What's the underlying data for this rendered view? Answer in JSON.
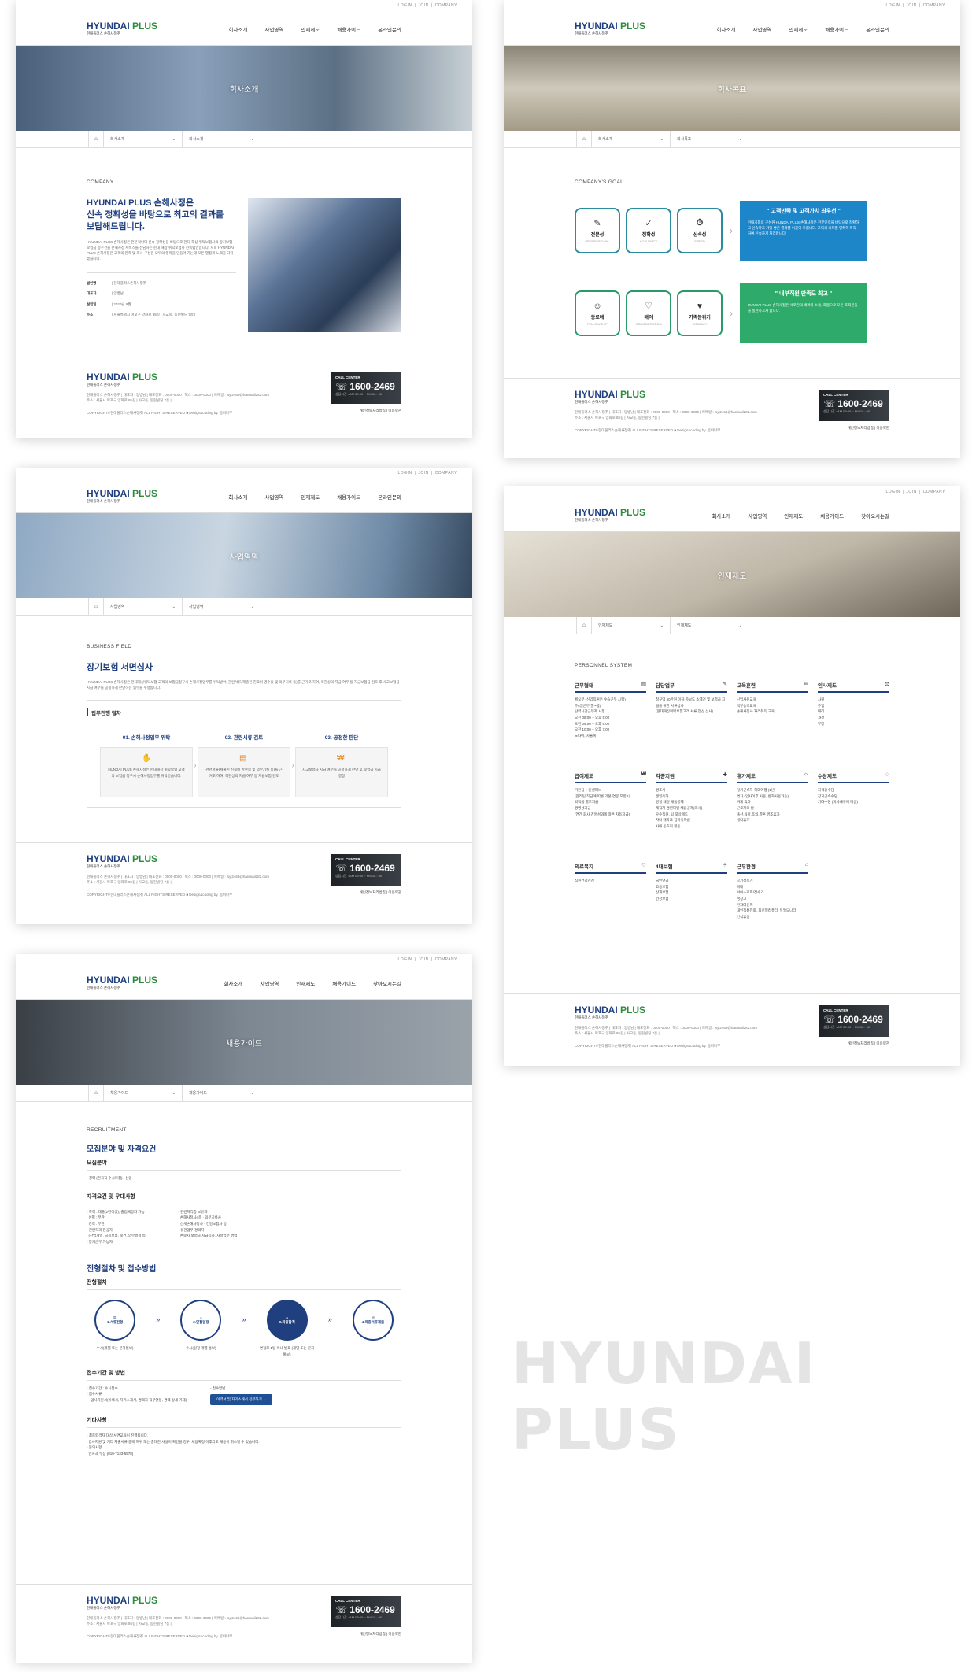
{
  "common": {
    "util": [
      "LOGIN",
      "JOIN",
      "COMPANY"
    ],
    "logo_main": "HYUNDAI ",
    "logo_accent": "PLUS",
    "logo_sub": "현대플러스 손해사정㈜",
    "menu_a": [
      "회사소개",
      "사업영역",
      "인재제도",
      "채용가이드",
      "온라인문의"
    ],
    "menu_b": [
      "회사소개",
      "사업영역",
      "인재제도",
      "채용가이드",
      "찾아오시는길"
    ],
    "footer_info": "현대플러스 손해사정㈜ | 대표자 : 양병남 | 대표전화 : 0000-0000 | 팩스 : 0000-0000 | 이메일 : lsyj2469@hanmail282.com",
    "footer_addr": "주소 : 서울시 마포구 양화로 85길 | 사교동, 동현빌딩 7층 |",
    "copyright": "COPYRIGHT©현대플러스손해사정㈜ ALL RIGHTS RESERVED ■ Design&coding by. 봄비나무",
    "cc_label": "CALL CENTER",
    "cc_number": "1600-2469",
    "cc_hours": "상담시간 : AM 09:00 ~ PM 18 : 00",
    "footer_links": "개인정보처리방침  |  이용약관"
  },
  "pageA": {
    "hero": "회사소개",
    "lnb": [
      "회사소개",
      "회사소개"
    ],
    "en": "COMPANY",
    "title1": "HYUNDAI PLUS 손해사정은",
    "title2": "신속 정확성을 바탕으로 최고의 결과를",
    "title3": "보답해드립니다.",
    "desc": "HYUNDAI PLUS 손해사정은 전문적이며 신속 정확성을 바탕으로 현대 해상 위탁보험사의 장기보험 보험금 청구건을 손해사정 서비스를 전담하는 현대 해상 위탁보험사 전속법인입니다. 저희 HYUNDAI PLUS 손해사정은 고객의 만족 및 회사 구성원 모두의 행복을 만들어 가는데 모든 열정과 노력을 다하겠습니다.",
    "info": [
      {
        "k": "법인명",
        "v": "| 현대플러스손해사정㈜"
      },
      {
        "k": "대표자",
        "v": "| 양병남"
      },
      {
        "k": "설립일",
        "v": "| 2020년 8월"
      },
      {
        "k": "주소",
        "v": "| 서울특별시 마포구 양화로 85길 | 사교동, 동현빌딩 7층 |"
      }
    ]
  },
  "pageB": {
    "hero": "회사목표",
    "lnb": [
      "회사소개",
      "회사목표"
    ],
    "en": "COMPANY'S GOAL",
    "row1": [
      {
        "t": "전문성",
        "e": "PROFESSIONAL",
        "i": "✎"
      },
      {
        "t": "정확성",
        "e": "ACCURACY",
        "i": "✓"
      },
      {
        "t": "신속성",
        "e": "SPEED",
        "i": "⏱"
      }
    ],
    "row2": [
      {
        "t": "동료애",
        "e": "FELLOWSHIP",
        "i": "☺"
      },
      {
        "t": "배려",
        "e": "CONSIDERATION",
        "i": "♡"
      },
      {
        "t": "가족분위기",
        "e": "INTIMACY",
        "i": "♥"
      }
    ],
    "big1_t": "\" 고객만족 및 고객가치 최우선 \"",
    "big1_d": "현대기룹의 구성원 HUNDAI PLUS 손해사정은 전문인력을 바탕으로 정확하고 신속하고 가장 좋은 결과를 이끌어 드립니다. 고객의 니즈를 정확히 파악하여 신속하게 처리합니다.",
    "big2_t": "\" 내부직원 만족도 최고 \"",
    "big2_d": "HUNDAI PLUS 손해사정은 서로간의 배려와 소통, 화합으로 모든 조직원들을 실현하고자 합니다."
  },
  "pageC": {
    "hero": "사업영역",
    "lnb": [
      "사업영역",
      "사업영역"
    ],
    "en": "BUSINESS FIELD",
    "title": "장기보험 서면심사",
    "desc": "HYUNDAI PLUS 손해사정은 현대해상위탁보험 고객의 보험금청구시 손해사정업무를 위탁받아, 관련서류(제출된 진료비 영수증 및 의무기록 등)를 근거로 하여, 약관상의 지급 여부 등 지급보험금 검토 후 사고보험금 지급 여부를 공정하게 판단하는 업무를 수행합니다.",
    "proc": "업무진행 절차",
    "steps": [
      {
        "t": "01. 손해사정업무 위탁",
        "d": "HUNDAI PLUS 손해사정은 현대해상 위탁보험 고객의 보험금 청구시 손해사정업무를 위탁받습니다."
      },
      {
        "t": "02. 관련서류 검토",
        "d": "관련서류(제출된 진료비 영수증 및 의무기록 등)를 근거로 하여, 약관상의 지급 여부 등 지급보험 검토"
      },
      {
        "t": "03. 공정한 판단",
        "d": "사고보험금 지급 여부를 공정하게 판단 후 보험금 지급 결정"
      }
    ]
  },
  "pageD": {
    "hero": "인재제도",
    "lnb": [
      "인재제도",
      "인재제도"
    ],
    "en": "PERSONNEL SYSTEM",
    "cols": [
      {
        "t": "근무형태",
        "i": "▤",
        "items": [
          "월요부 (신입직원은 수습근무 시행)",
          "주5일근무(월~금)",
          "탄력시간근무제 시행",
          "오전 08:00 ~ 오후 5:00",
          "오전 09:00 ~ 오후 6:00",
          "오전 10:00 ~ 오후 7:00",
          "노타이, 자율복"
        ]
      },
      {
        "t": "담당업무",
        "i": "✎",
        "items": [
          "청구액 50만원 이하 자보도 소액건 및 보험금 지급을 위한 서류심사",
          "(현대해상위탁보험고객 서류 전산 심사)"
        ]
      },
      {
        "t": "교육훈련",
        "i": "✏",
        "items": [
          "신입사원교육",
          "직무능력교육",
          "손해사정사 자격취득 교육"
        ]
      },
      {
        "t": "인사제도",
        "i": "⚖",
        "items": [
          "사원",
          "주임",
          "대리",
          "과장",
          "부장"
        ]
      },
      {
        "t": "급여제도",
        "i": "₩",
        "items": [
          "기본급 + 인센티브",
          "(관리팀 직급에 따른 기본 연봉 포함시)",
          "퇴직금 별도지급",
          "경영성과금",
          "(연간 회사 경영성과에 따른 차등지급)"
        ]
      },
      {
        "t": "각종지원",
        "i": "✚",
        "items": [
          "경조사",
          "생일축하",
          "명절 내일 채움공제",
          "제직자 명년대일 채움공제(회사)",
          "우수직원, 팀 포상제도",
          "자녀 대학교 입학축하금",
          "사내 동호회 활동"
        ]
      },
      {
        "t": "휴가제도",
        "i": "☼",
        "items": [
          "정기근속자 해외여행 (1년)",
          "연차 (입사이후 사용, 반차사용가능)",
          "하계 휴가",
          "근로자의 날",
          "출산,육아,조의,결혼 경조휴가",
          "생리휴가"
        ]
      },
      {
        "t": "수당제도",
        "i": "♢",
        "items": [
          "자격증수당",
          "장기근속수당",
          "기타수당 (회사내규에 따름)"
        ]
      },
      {
        "t": "의료복지",
        "i": "♡",
        "items": [
          "직원건강검진"
        ]
      },
      {
        "t": "4대보험",
        "i": "☂",
        "items": [
          "국민연금",
          "고용보험",
          "산재보험",
          "건강보험"
        ]
      },
      {
        "t": "근무환경",
        "i": "⌂",
        "items": [
          "공기청정기",
          "비데",
          "아이스커피/정수기",
          "냉장고",
          "전자레인지",
          "개인직통전화, 최신형컴퓨터, 듀얼모니터",
          "안식휴공"
        ]
      }
    ]
  },
  "pageE": {
    "hero": "채용가이드",
    "lnb": [
      "채용가이드",
      "채용가이드"
    ],
    "en": "RECRUITMENT",
    "title1": "모집분야 및 자격요건",
    "s1": "모집분야",
    "s1v": "- 경력 (전국직 수시모집) / 신입",
    "s2": "자격요건 및 우대사항",
    "req": [
      "- 학력 : 대졸(2년이상), 졸업예정자 가능",
      "  성별 : 무관",
      "  경력 : 무관",
      "- 관련학과 전공자",
      "  (산업계열, 금융보험, 보건, 의무행정 등)",
      "- 장기근무 가능자"
    ],
    "pref": [
      "- 관련자격증 보유자",
      "  손해사정사4종 · 의무기록사",
      "  신체손해사정사 · 건강보험사 등",
      "- 유관업무 경력자",
      "  손보사 보험금 지급심사, 사정업무 경력"
    ],
    "title2": "전형절차 및 접수방법",
    "s3": "전형절차",
    "circles": [
      {
        "t": "1.서류전형",
        "d": "수시(개별 또는 문자통보)"
      },
      {
        "t": "2.면접일정",
        "d": "수시(일정 개별 통보)"
      },
      {
        "t": "3.최종합격",
        "d": "면접후 1일 이내 발표 (개별 또는 문자통보)"
      },
      {
        "t": "4.최종서류제출",
        "d": ""
      }
    ],
    "s4": "접수기간 및 방법",
    "recv1": "- 접수기간 : 수시접수",
    "recv2": "- 접수서류",
    "recv3": "  · 입사지원서(이력서, 자기소개서, 경력자 직무연봉, 경력 상세 기재)",
    "recv4": "- 접수방법",
    "btn": "이력서 및 자기소개서 접부하기 →",
    "s5": "기타사항",
    "etc1": "- 최종합격자 대상 서면교육이 진행됩니다.",
    "etc2": "  입사지원 및 기타 제출서류 중에 허위 또는 중대한 사실이 확인될 경우, 채용확정 이후라도 채용이 취소될 수 있습니다.",
    "etc3": "- 문의사항",
    "etc4": "  인사과 부장 (010-7133-5578)"
  },
  "watermark": "HYUNDAI PLUS"
}
